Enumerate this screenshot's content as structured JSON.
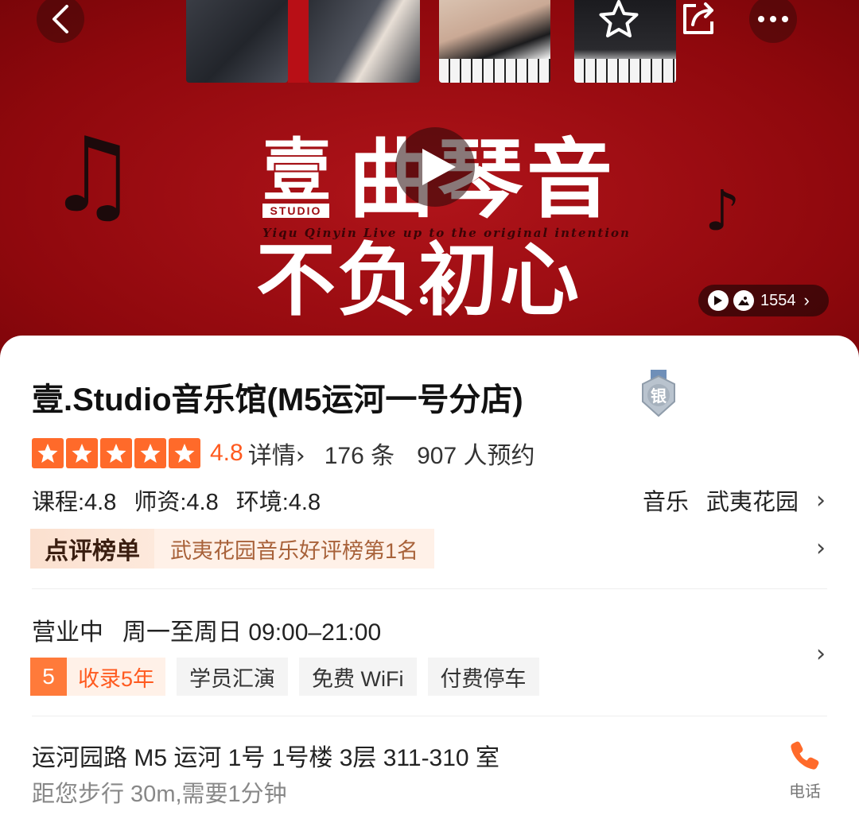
{
  "hero": {
    "logo_char": "壹",
    "logo_studio": "STUDIO",
    "title": "曲琴音",
    "tagline": "Yiqu Qinyin Live up to the original intention",
    "slogan": "不负初心",
    "media_count": "1554",
    "carousel": {
      "total": 3,
      "active": 0
    }
  },
  "shop": {
    "name": "壹.Studio音乐馆(M5运河一号分店)",
    "badge": "银",
    "score": "4.8",
    "stars": 5,
    "detail_label": "详情",
    "reviews": "176 条",
    "bookings": "907 人预约",
    "sub_scores": [
      "课程:4.8",
      "师资:4.8",
      "环境:4.8"
    ],
    "category": "音乐",
    "area": "武夷花园"
  },
  "rank": {
    "label": "点评榜单",
    "text": "武夷花园音乐好评榜第1名"
  },
  "hours": {
    "status": "营业中",
    "schedule": "周一至周日 09:00–21:00"
  },
  "tags": {
    "years_num": "5",
    "years_text": "收录5年",
    "items": [
      "学员汇演",
      "免费 WiFi",
      "付费停车"
    ]
  },
  "location": {
    "address": "运河园路 M5 运河 1号 1号楼 3层 311-310 室",
    "distance": "距您步行 30m,需要1分钟",
    "phone_label": "电话"
  },
  "colors": {
    "hero_red": "#9c0a10",
    "accent_orange": "#ff5a1f",
    "star_orange": "#ff6a2a"
  },
  "icons": [
    "back-icon",
    "star-icon",
    "share-icon",
    "more-icon",
    "play-icon",
    "video-icon",
    "image-icon",
    "chevron-right-icon",
    "phone-icon",
    "silver-badge-icon",
    "music-note-icon"
  ]
}
